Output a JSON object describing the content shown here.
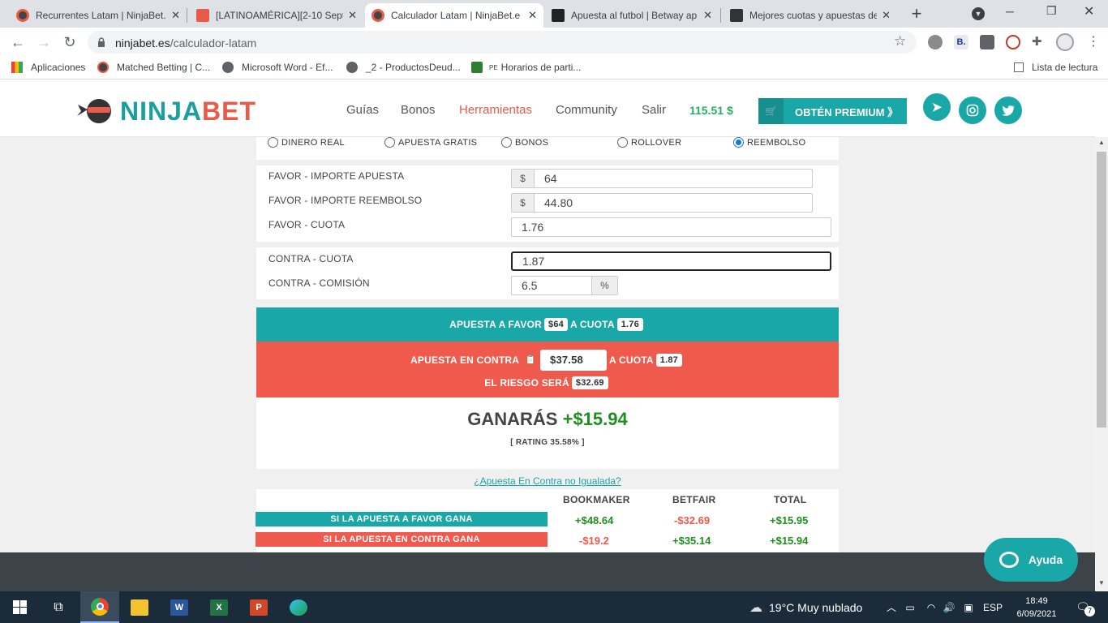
{
  "browser": {
    "tabs": [
      {
        "title": "Recurrentes Latam | NinjaBet.",
        "active": false
      },
      {
        "title": "[LATINOAMÉRICA][2-10 Sept",
        "active": false
      },
      {
        "title": "Calculador Latam | NinjaBet.e",
        "active": true
      },
      {
        "title": "Apuesta al futbol | Betway ap",
        "active": false
      },
      {
        "title": "Mejores cuotas y apuestas de",
        "active": false
      }
    ],
    "new_tab": "+",
    "url_host": "ninjabet.es",
    "url_path": "/calculador-latam",
    "bookmarks": [
      {
        "label": "Aplicaciones"
      },
      {
        "label": "Matched Betting | C..."
      },
      {
        "label": "Microsoft Word - Ef..."
      },
      {
        "label": "_2 - ProductosDeud..."
      },
      {
        "label": "Horarios de parti..."
      }
    ],
    "bookmark_prefix_pe": "PE",
    "reading_list": "Lista de lectura"
  },
  "site": {
    "logo_left": "NINJA",
    "logo_right": "BET",
    "nav": [
      {
        "label": "Guías",
        "active": false
      },
      {
        "label": "Bonos",
        "active": false
      },
      {
        "label": "Herramientas",
        "active": true
      },
      {
        "label": "Community",
        "active": false
      },
      {
        "label": "Salir",
        "active": false
      }
    ],
    "balance": "115.51 $",
    "premium_label": "OBTÉN PREMIUM 》"
  },
  "calculator": {
    "modes": [
      {
        "label": "DINERO REAL",
        "selected": false
      },
      {
        "label": "APUESTA GRATIS",
        "selected": false
      },
      {
        "label": "BONOS",
        "selected": false
      },
      {
        "label": "ROLLOVER",
        "selected": false
      },
      {
        "label": "REEMBOLSO",
        "selected": true
      }
    ],
    "currency": "$",
    "percent": "%",
    "favor_stake_label": "FAVOR - IMPORTE APUESTA",
    "favor_stake": "64",
    "favor_refund_label": "FAVOR - IMPORTE REEMBOLSO",
    "favor_refund": "44.80",
    "favor_odds_label": "FAVOR - CUOTA",
    "favor_odds": "1.76",
    "contra_odds_label": "CONTRA - CUOTA",
    "contra_odds": "1.87",
    "contra_comm_label": "CONTRA - COMISIÓN",
    "contra_comm": "6.5"
  },
  "result": {
    "favor_text": "APUESTA A FAVOR",
    "favor_amount": "$64",
    "a_cuota": "A CUOTA",
    "favor_odds": "1.76",
    "contra_text": "APUESTA EN CONTRA",
    "contra_amount": "$37.58",
    "contra_odds": "1.87",
    "risk_text": "EL RIESGO SERÁ",
    "risk_amount": "$32.69",
    "win_text": "GANARÁS",
    "win_amount": "+$15.94",
    "rating": "[ RATING 35.58% ]",
    "unmatched_link": "¿Apuesta En Contra no Igualada?"
  },
  "table": {
    "headers": [
      "BOOKMAKER",
      "BETFAIR",
      "TOTAL"
    ],
    "rows": [
      {
        "label": "SI LA APUESTA A FAVOR GANA",
        "bookmaker": "+$48.64",
        "betfair": "-$32.69",
        "total": "+$15.95"
      },
      {
        "label": "SI LA APUESTA EN CONTRA GANA",
        "bookmaker": "-$19.2",
        "betfair": "+$35.14",
        "total": "+$15.94"
      }
    ]
  },
  "chat": {
    "label": "Ayuda"
  },
  "taskbar": {
    "weather": "19°C  Muy nublado",
    "lang": "ESP",
    "time": "18:49",
    "date": "6/09/2021",
    "notifications": "7"
  },
  "colors": {
    "teal": "#1aa7a7",
    "coral": "#e95b48",
    "green": "#1e8f1e"
  }
}
